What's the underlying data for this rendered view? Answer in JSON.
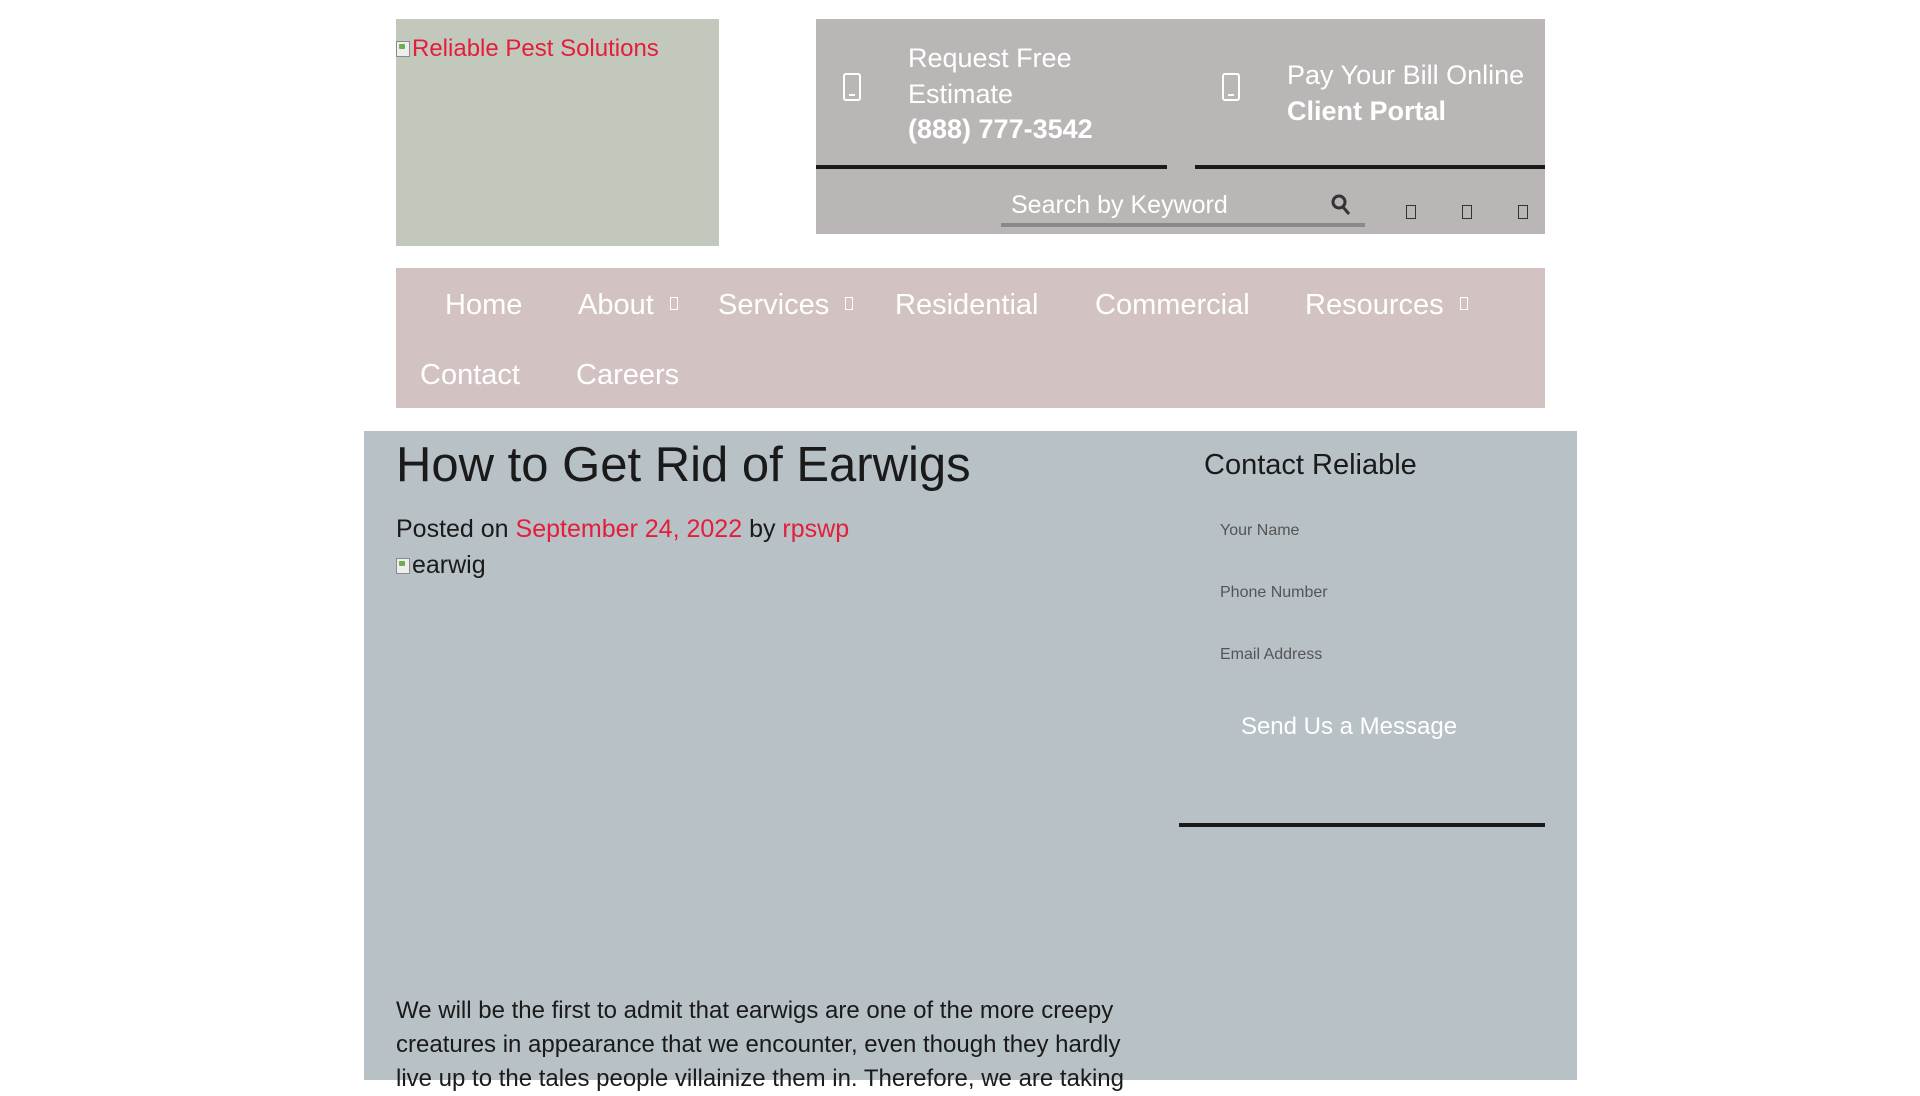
{
  "brand": {
    "logo_alt": "Reliable Pest Solutions",
    "link_color": "#e41e3a"
  },
  "header": {
    "estimate": {
      "label": "Request Free Estimate",
      "phone": "(888) 777-3542"
    },
    "portal": {
      "label": "Pay Your Bill Online",
      "link": "Client Portal"
    },
    "search": {
      "placeholder": "Search by Keyword",
      "button_icon": "search-icon"
    },
    "social_icons": [
      "facebook-icon",
      "twitter-icon",
      "instagram-icon"
    ]
  },
  "nav": {
    "items": [
      {
        "label": "Home"
      },
      {
        "label": "About",
        "has_submenu": true
      },
      {
        "label": "Services",
        "has_submenu": true
      },
      {
        "label": "Residential"
      },
      {
        "label": "Commercial"
      },
      {
        "label": "Resources",
        "has_submenu": true
      },
      {
        "label": "Contact"
      },
      {
        "label": "Careers"
      }
    ]
  },
  "post": {
    "title": "How to Get Rid of Earwigs",
    "meta_posted": "Posted on",
    "date": "September 24, 2022",
    "meta_by": "by",
    "author": "rpswp",
    "image_alt": "earwig",
    "body": "We will be the first to admit that earwigs are one of the more creepy creatures in appearance that we encounter, even though they hardly live up to the tales people villainize them in. Therefore, we are taking"
  },
  "sidebar": {
    "title": "Contact Reliable",
    "name_placeholder": "Your Name",
    "phone_placeholder": "Phone Number",
    "email_placeholder": "Email Address",
    "submit_label": "Send Us a Message"
  }
}
